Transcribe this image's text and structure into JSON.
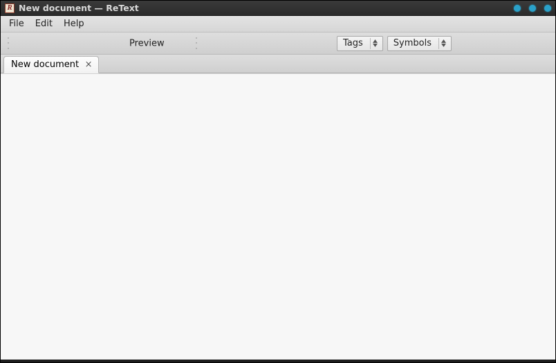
{
  "window": {
    "title": "New document — ReText",
    "app_icon_letter": "R"
  },
  "menubar": {
    "items": [
      "File",
      "Edit",
      "Help"
    ]
  },
  "toolbar": {
    "preview_label": "Preview",
    "tags_select": "Tags",
    "symbols_select": "Symbols"
  },
  "tabs": [
    {
      "label": "New document"
    }
  ],
  "editor": {
    "content": ""
  }
}
